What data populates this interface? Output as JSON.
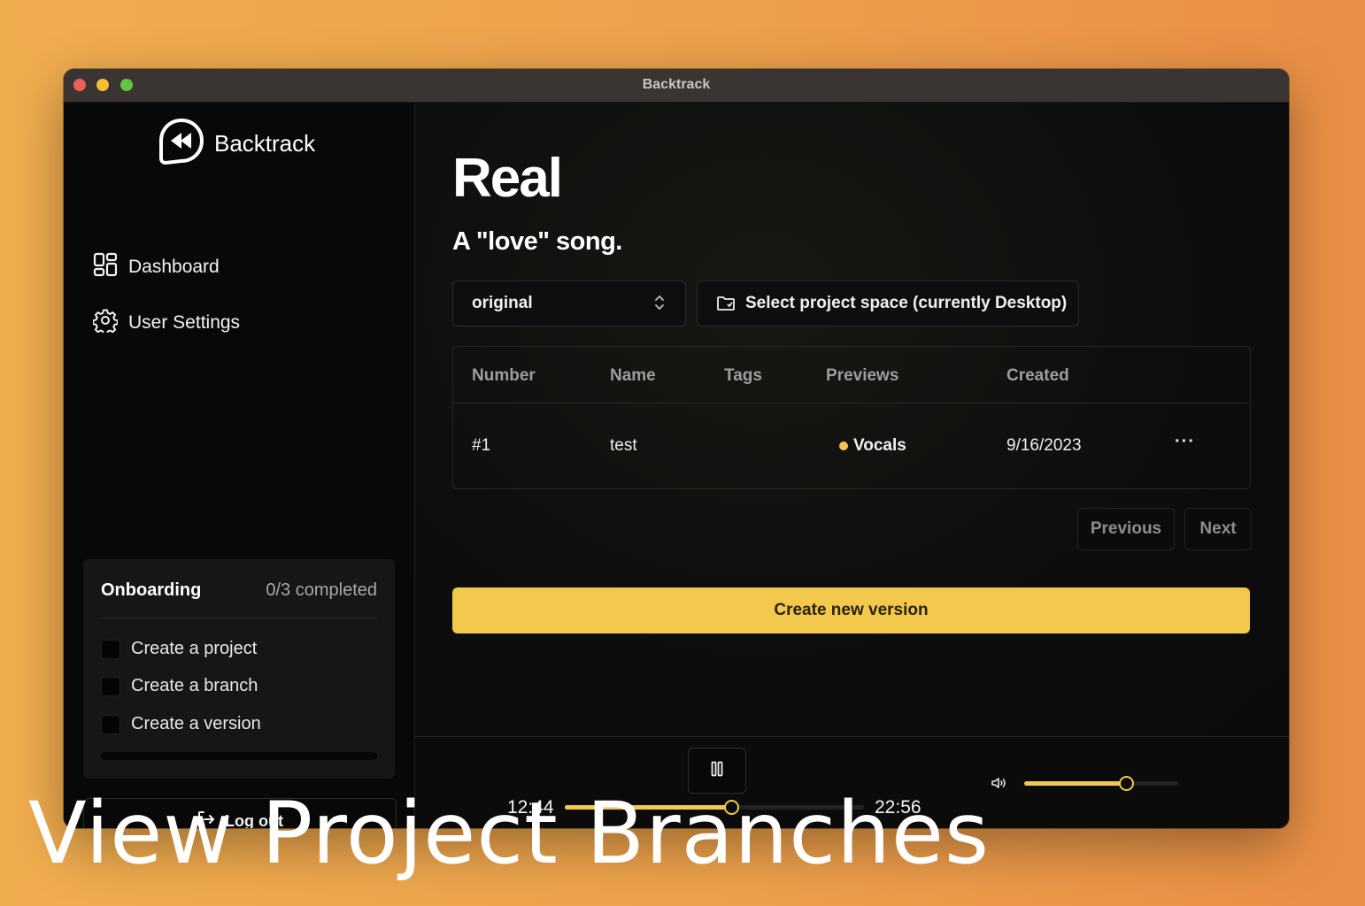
{
  "window": {
    "title": "Backtrack"
  },
  "sidebar": {
    "brand": "Backtrack",
    "nav": [
      {
        "label": "Dashboard",
        "icon": "dashboard-icon"
      },
      {
        "label": "User Settings",
        "icon": "gear-icon"
      }
    ],
    "onboarding": {
      "title": "Onboarding",
      "count": "0/3 completed",
      "tasks": [
        "Create a project",
        "Create a branch",
        "Create a version"
      ],
      "progress": 0
    },
    "logout": "Log out"
  },
  "project": {
    "title": "Real",
    "subtitle": "A \"love\" song.",
    "branch": "original",
    "space_button": "Select project space (currently Desktop)"
  },
  "table": {
    "headers": [
      "Number",
      "Name",
      "Tags",
      "Previews",
      "Created"
    ],
    "rows": [
      {
        "number": "#1",
        "name": "test",
        "tags": "",
        "preview": "Vocals",
        "created": "9/16/2023"
      }
    ],
    "row_menu": "···"
  },
  "pagination": {
    "previous": "Previous",
    "next": "Next"
  },
  "create_button": "Create new version",
  "player": {
    "current_time": "12:44",
    "total_time": "22:56",
    "progress": 0.555,
    "volume": 0.66
  },
  "caption": "View Project Branches",
  "colors": {
    "accent": "#f2c94c",
    "background": "#0c0c0c"
  }
}
